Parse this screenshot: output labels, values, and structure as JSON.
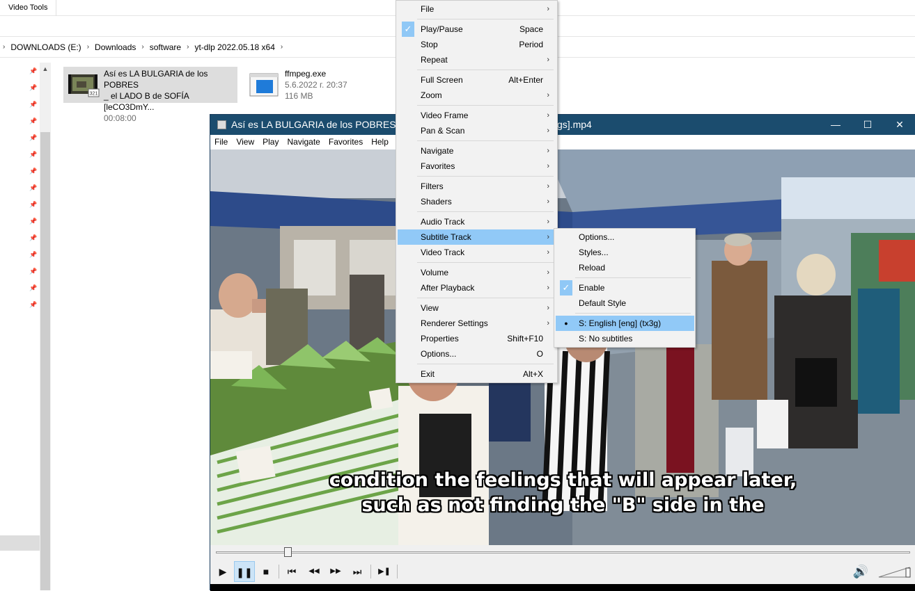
{
  "explorer": {
    "ribbon_tab": "Video Tools",
    "breadcrumb": [
      "DOWNLOADS (E:)",
      "Downloads",
      "software",
      "yt-dlp 2022.05.18 x64"
    ],
    "files": [
      {
        "name_line1": "Así es LA  BULGARIA de los POBRES",
        "name_line2": "_ el LADO B de SOFÍA [leCO3DmY...",
        "meta1": "00:08:00",
        "meta2": "",
        "icon": "video-file-icon",
        "thumb_badge": "321"
      },
      {
        "name_line1": "ffmpeg.exe",
        "name_line2": "",
        "meta1": "5.6.2022 г. 20:37",
        "meta2": "116 MB",
        "icon": "exe-file-icon"
      }
    ],
    "pin_icon": "pin-icon",
    "pin_count": 15
  },
  "player": {
    "title_left": "Así es LA  BULGARIA de los POBRES",
    "title_right": "gs].mp4",
    "window_buttons": {
      "minimize": "—",
      "maximize": "☐",
      "close": "✕"
    },
    "menubar": [
      "File",
      "View",
      "Play",
      "Navigate",
      "Favorites",
      "Help"
    ],
    "subtitle_line1": "condition the feelings that will appear later,",
    "subtitle_line2": "such as not finding the \"B\" side in the",
    "seek_progress": 0.103,
    "volume_level": 0.95,
    "controls": {
      "play": "▶",
      "pause": "❚❚",
      "stop": "■",
      "prev": "⏮",
      "rewind": "◀◀",
      "forward": "▶▶",
      "next": "⏭",
      "frame_step": "▶❚"
    }
  },
  "context_menu": {
    "items": [
      {
        "label": "File",
        "shortcut": "",
        "submenu": true
      },
      {
        "label": "Play/Pause",
        "shortcut": "Space",
        "checked": true
      },
      {
        "label": "Stop",
        "shortcut": "Period"
      },
      {
        "label": "Repeat",
        "shortcut": "",
        "submenu": true
      },
      {
        "label": "Full Screen",
        "shortcut": "Alt+Enter"
      },
      {
        "label": "Zoom",
        "shortcut": "",
        "submenu": true
      },
      {
        "label": "Video Frame",
        "shortcut": "",
        "submenu": true
      },
      {
        "label": "Pan & Scan",
        "shortcut": "",
        "submenu": true
      },
      {
        "label": "Navigate",
        "shortcut": "",
        "submenu": true
      },
      {
        "label": "Favorites",
        "shortcut": "",
        "submenu": true
      },
      {
        "label": "Filters",
        "shortcut": "",
        "submenu": true
      },
      {
        "label": "Shaders",
        "shortcut": "",
        "submenu": true
      },
      {
        "label": "Audio Track",
        "shortcut": "",
        "submenu": true
      },
      {
        "label": "Subtitle Track",
        "shortcut": "",
        "submenu": true,
        "highlighted": true
      },
      {
        "label": "Video Track",
        "shortcut": "",
        "submenu": true
      },
      {
        "label": "Volume",
        "shortcut": "",
        "submenu": true
      },
      {
        "label": "After Playback",
        "shortcut": "",
        "submenu": true
      },
      {
        "label": "View",
        "shortcut": "",
        "submenu": true
      },
      {
        "label": "Renderer Settings",
        "shortcut": "",
        "submenu": true
      },
      {
        "label": "Properties",
        "shortcut": "Shift+F10"
      },
      {
        "label": "Options...",
        "shortcut": "O"
      },
      {
        "label": "Exit",
        "shortcut": "Alt+X"
      }
    ],
    "arrow": "›",
    "check": "✓"
  },
  "subtitle_menu": {
    "items": [
      {
        "label": "Options..."
      },
      {
        "label": "Styles..."
      },
      {
        "label": "Reload"
      },
      {
        "label": "Enable",
        "checked": true
      },
      {
        "label": "Default Style"
      },
      {
        "label": "S: English [eng] (tx3g)",
        "radio": true,
        "highlighted": true
      },
      {
        "label": "S: No subtitles"
      }
    ],
    "dot": "●"
  },
  "colors": {
    "title_bar": "#1b4c6e",
    "menu_highlight": "#91c9f7",
    "check_bg": "#90c8f6"
  }
}
